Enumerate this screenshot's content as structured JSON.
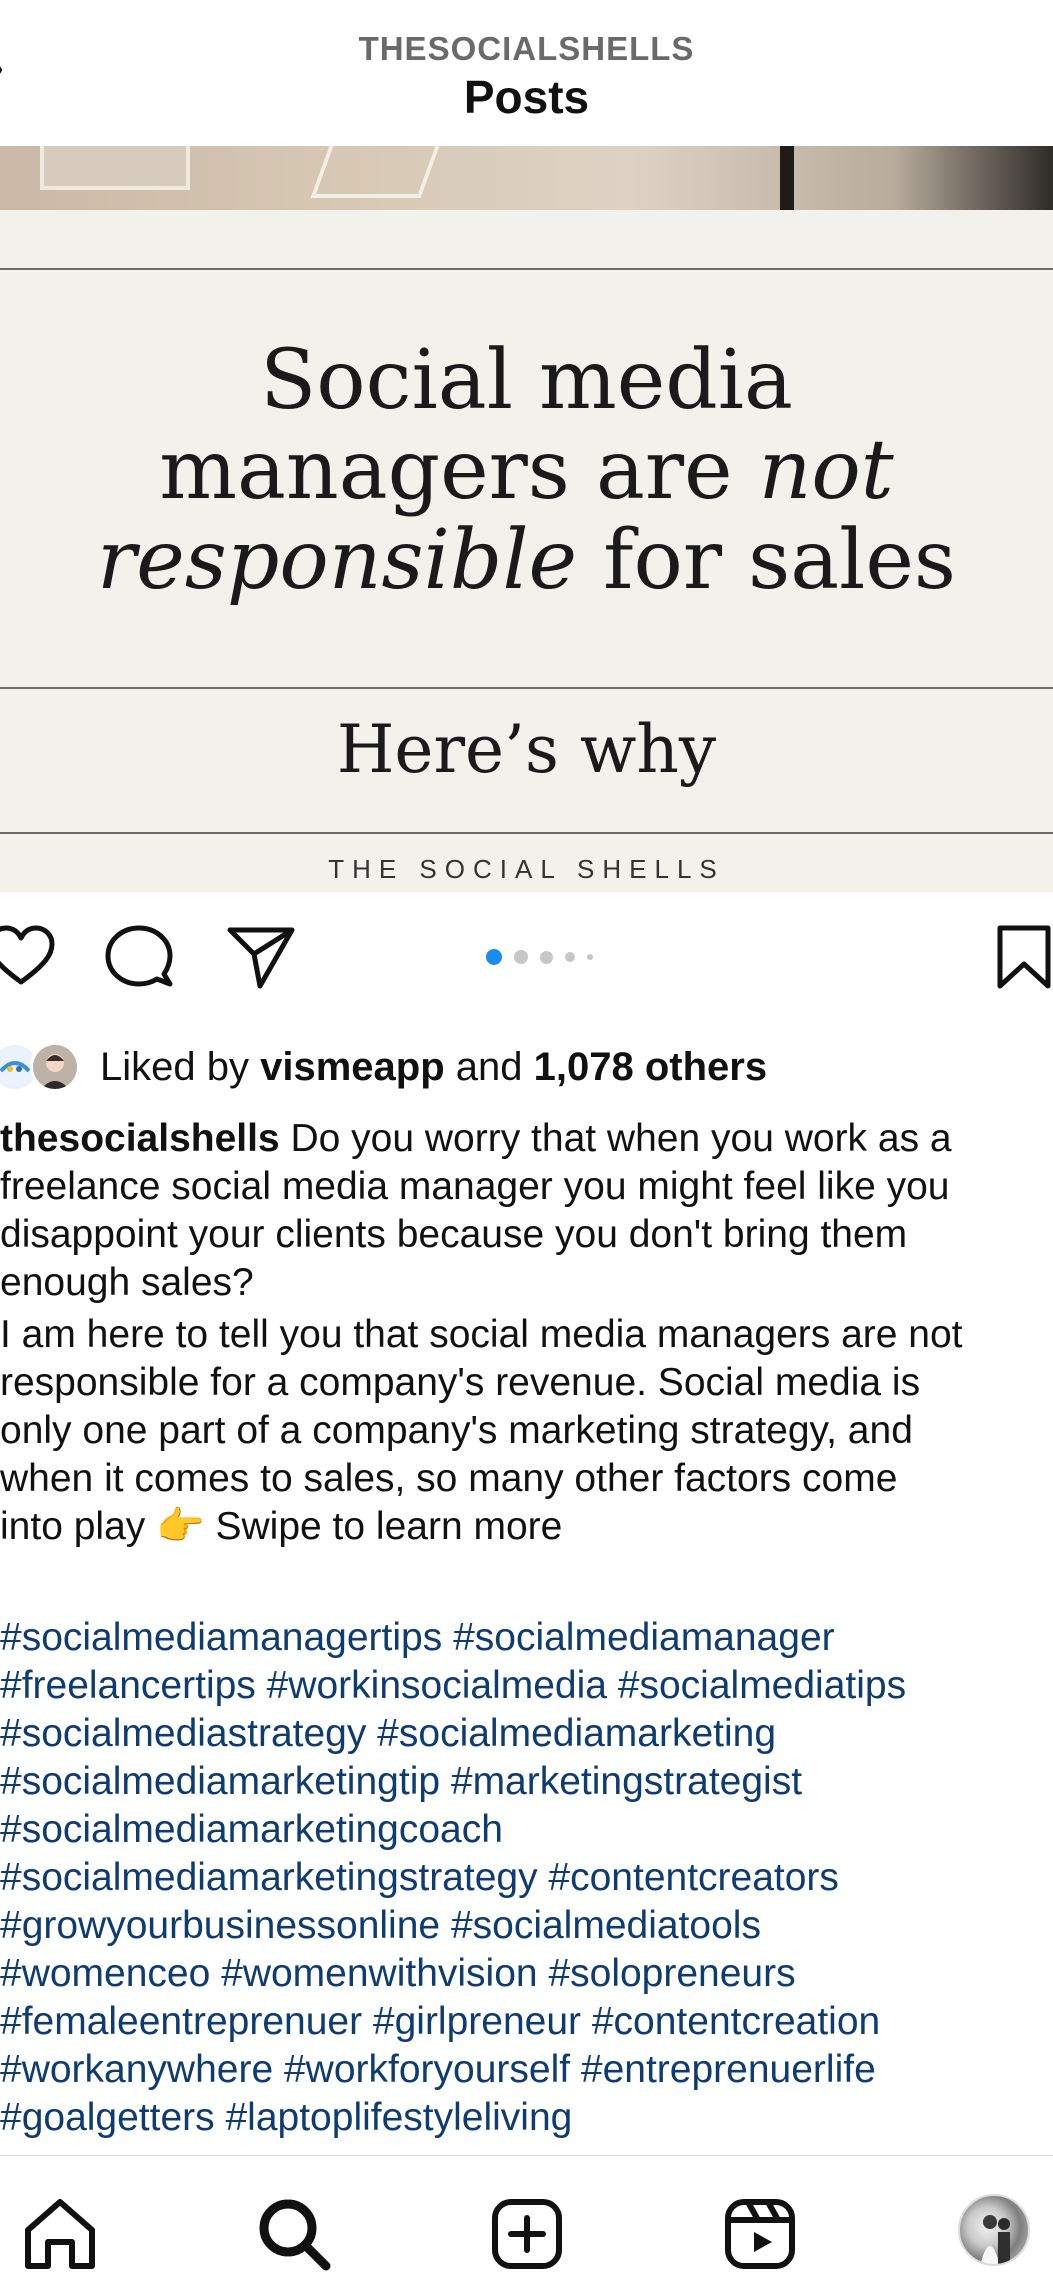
{
  "header": {
    "username": "THESOCIALSHELLS",
    "title": "Posts"
  },
  "post": {
    "headline_line1": "Social media",
    "headline_line2_start": "managers are ",
    "headline_line2_italic": "not",
    "headline_line3_italic": "responsible",
    "headline_line3_end": " for sales",
    "subhead": "Here’s why",
    "brand": "THE SOCIAL SHELLS"
  },
  "carousel": {
    "total": 5,
    "active_index": 0,
    "active_color": "#1a8cf0"
  },
  "likes": {
    "prefix": "Liked by ",
    "user": "vismeapp",
    "middle": " and ",
    "others": "1,078 others"
  },
  "caption": {
    "username": "thesocialshells",
    "text1": " Do you worry that when you work as a\nfreelance social media manager you might feel like you\ndisappoint your clients because you don't bring them\nenough sales?",
    "text2": "I am here to tell you that social media managers are not\nresponsible for a company's revenue. Social media is\nonly one part of a company's marketing strategy, and\nwhen it comes to sales, so many other factors come\ninto play 👉 Swipe to learn more"
  },
  "hashtags": [
    "#socialmediamanagertips #socialmediamanager",
    "#freelancertips #workinsocialmedia #socialmediatips",
    "#socialmediastrategy #socialmediamarketing",
    "#socialmediamarketingtip #marketingstrategist",
    "#socialmediamarketingcoach",
    "#socialmediamarketingstrategy #contentcreators",
    "#growyourbusinessonline #socialmediatools",
    "#womenceo #womenwithvision #solopreneurs",
    "#femaleentreprenuer #girlpreneur #contentcreation",
    "#workanywhere #workforyourself #entreprenuerlife",
    "#goalgetters #laptoplifestyleliving"
  ],
  "colors": {
    "hashtag": "#0e3b70",
    "poster_bg": "#f3f1ec"
  },
  "icons": {
    "like": "heart-icon",
    "comment": "comment-icon",
    "share": "paper-plane-icon",
    "save": "bookmark-icon",
    "home": "home-icon",
    "search": "search-icon",
    "create": "plus-square-icon",
    "reels": "reels-icon"
  }
}
